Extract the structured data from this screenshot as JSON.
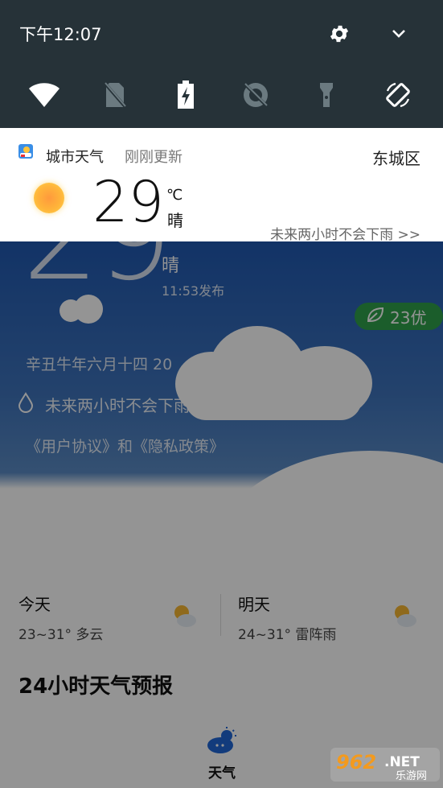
{
  "status_bar": {
    "time": "下午12:07"
  },
  "quick_settings": {
    "icons": [
      "wifi-icon",
      "no-sim-icon",
      "battery-charging-icon",
      "data-saver-icon",
      "flashlight-icon",
      "auto-rotate-icon"
    ]
  },
  "notification": {
    "app_name": "城市天气",
    "updated": "刚刚更新",
    "location": "东城区",
    "temperature": "29",
    "unit": "℃",
    "condition": "晴",
    "rain_forecast": "未来两小时不会下雨 >>"
  },
  "app": {
    "big_temp": "29",
    "condition": "晴",
    "published": "11:53发布",
    "aqi": "23优",
    "lunar_date": "辛丑牛年六月十四 20",
    "rain_forecast": "未来两小时不会下雨 >>",
    "agreement_links": "《用户协议》和《隐私政策》",
    "today": {
      "label": "今天",
      "detail": "23~31° 多云"
    },
    "tomorrow": {
      "label": "明天",
      "detail": "24~31° 雷阵雨"
    },
    "hourly_title": "24小时天气预报",
    "bottom_tab": "天气"
  },
  "watermark": {
    "text": "962.NET",
    "sub": "乐游网"
  }
}
